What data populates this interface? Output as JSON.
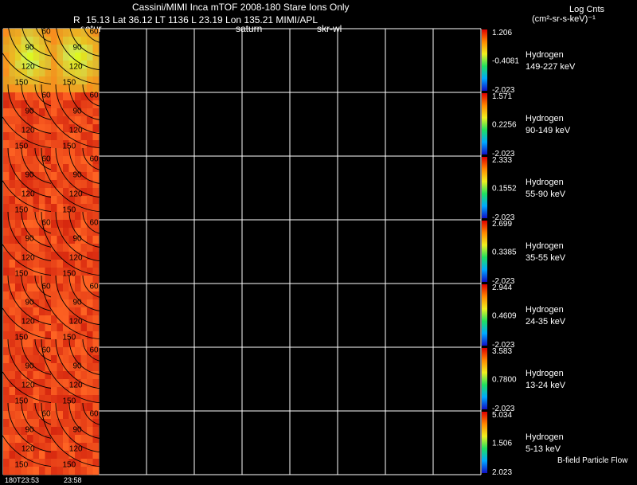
{
  "header": {
    "title": "Cassini/MIMI Inca mTOF  2008-180   Stare    Ions Only",
    "info": "15.13 Lat 36.12 LT 1136 L         23.19 Lon         135.21  MIMI/APL",
    "r_label": "R",
    "satur_label": "satur",
    "saturn_label": "saturn",
    "skr_label": "skr-wl"
  },
  "colorbar_title": "Log Cnts",
  "colorbar_units": "(cm²-sr-s-keV)⁻¹",
  "bottom_times": [
    "180T23:53",
    "23:58"
  ],
  "bfield_label": "B-field Particle Flow",
  "colors": {
    "background": "#000000",
    "grid": "#ffffff",
    "image_hot": "#e8381a",
    "image_top_row": "#d9e040"
  },
  "chart_data": {
    "type": "heatmap",
    "species": "Hydrogen",
    "image_columns": 2,
    "total_columns": 10,
    "contour_labels": [
      "60",
      "90",
      "120",
      "150"
    ],
    "rows": [
      {
        "energy": "149-227 keV",
        "max": "1.206",
        "mid": "-0.4081",
        "min": "-2.023"
      },
      {
        "energy": "90-149 keV",
        "max": "1.571",
        "mid": "0.2256",
        "min": "-2.023"
      },
      {
        "energy": "55-90 keV",
        "max": "2.333",
        "mid": "0.1552",
        "min": "-2.023"
      },
      {
        "energy": "35-55 keV",
        "max": "2.699",
        "mid": "0.3385",
        "min": "-2.023"
      },
      {
        "energy": "24-35 keV",
        "max": "2.944",
        "mid": "0.4609",
        "min": "-2.023"
      },
      {
        "energy": "13-24 keV",
        "max": "3.583",
        "mid": "0.7800",
        "min": "-2.023"
      },
      {
        "energy": "5-13 keV",
        "max": "5.034",
        "mid": "1.506",
        "min": "2.023"
      }
    ]
  }
}
